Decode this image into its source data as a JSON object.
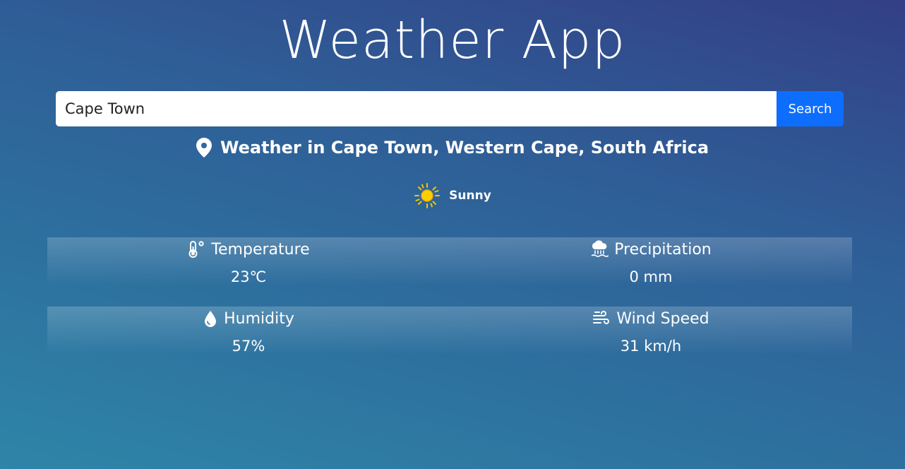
{
  "app": {
    "title": "Weather App"
  },
  "search": {
    "value": "Cape Town",
    "button_label": "Search"
  },
  "location": {
    "text": "Weather in Cape Town, Western Cape, South Africa",
    "icon": "map-pin-icon"
  },
  "condition": {
    "text": "Sunny",
    "icon": "sun-icon"
  },
  "stats": {
    "temperature": {
      "label": "Temperature",
      "value": "23℃",
      "icon": "thermometer-icon"
    },
    "precipitation": {
      "label": "Precipitation",
      "value": "0 mm",
      "icon": "rain-cloud-icon"
    },
    "humidity": {
      "label": "Humidity",
      "value": "57%",
      "icon": "droplet-icon"
    },
    "wind": {
      "label": "Wind Speed",
      "value": "31 km/h",
      "icon": "wind-icon"
    }
  },
  "colors": {
    "accent": "#0d6efd",
    "text": "#ffffff",
    "sun": "#f5c400"
  }
}
